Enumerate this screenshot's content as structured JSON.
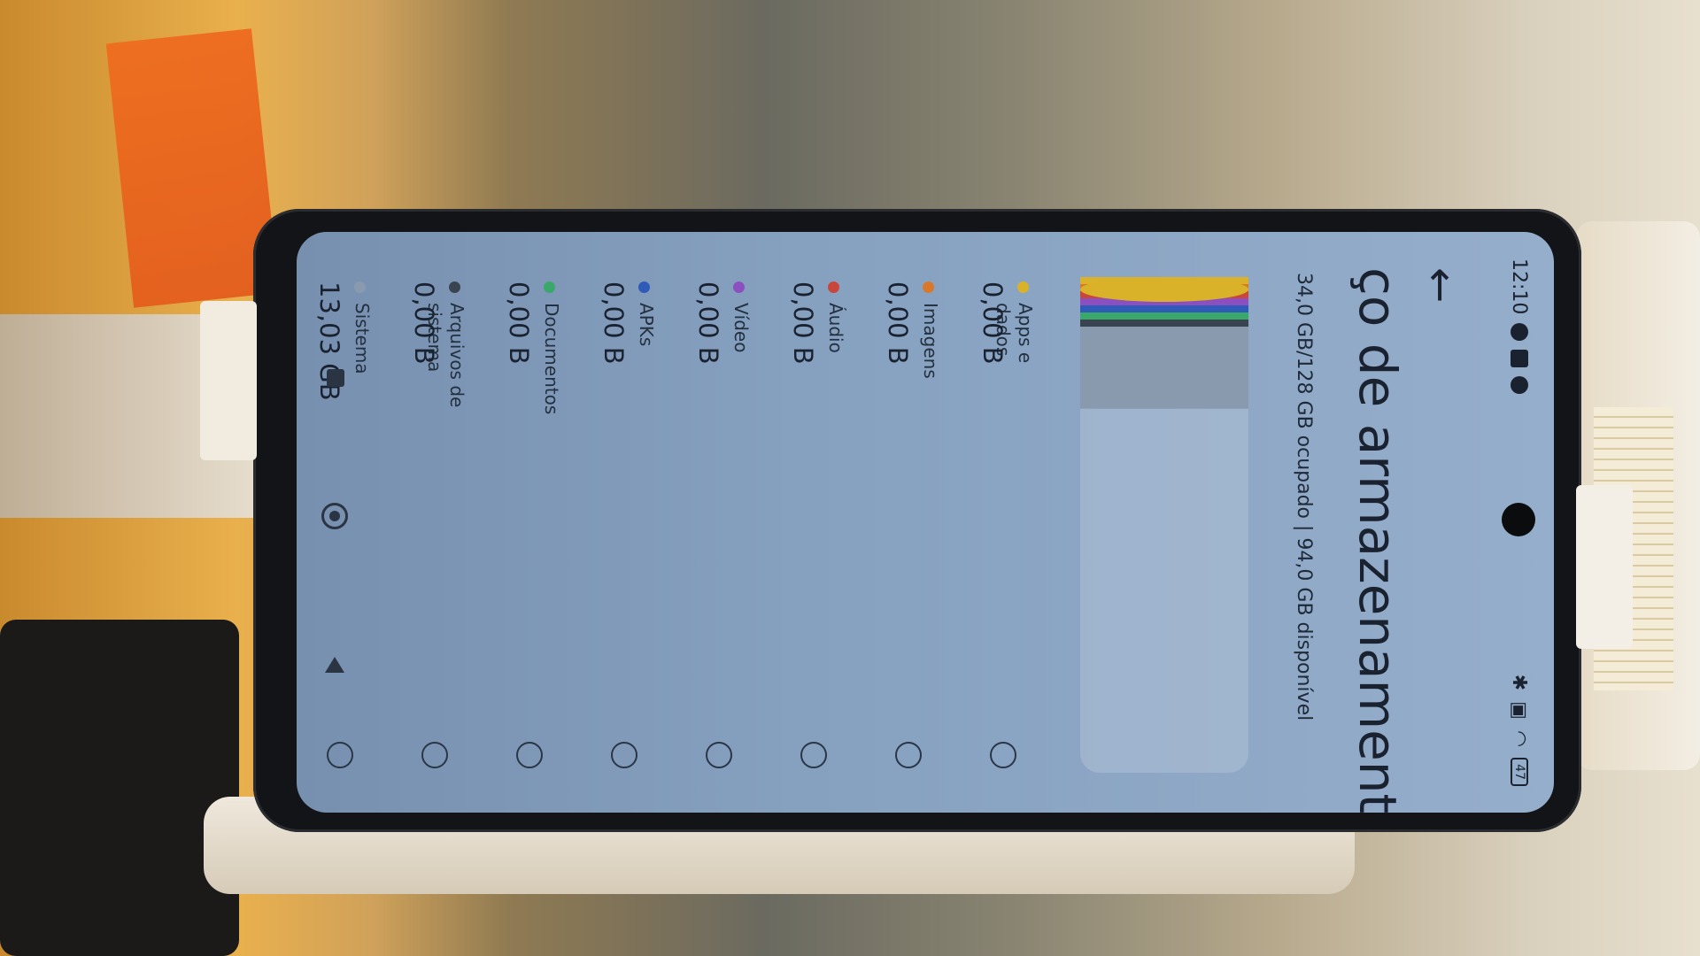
{
  "status_bar": {
    "time": "12:10",
    "battery": "47"
  },
  "header": {
    "back_icon": "arrow-back-icon",
    "title": "ço de armazenamento"
  },
  "storage": {
    "summary": "34,0 GB/128 GB ocupado | 94,0 GB disponível",
    "used_gb": 34.0,
    "total_gb": 128,
    "free_gb": 94.0
  },
  "chart_data": {
    "type": "bar",
    "title": "",
    "categories": [
      "Apps e dados",
      "Imagens",
      "Áudio",
      "Vídeo",
      "APKs",
      "Documentos",
      "Arquivos de sistema",
      "Sistema"
    ],
    "values_text": [
      "0,00 B",
      "0,00 B",
      "0,00 B",
      "0,00 B",
      "0,00 B",
      "0,00 B",
      "0,00 B",
      "13,03 GB"
    ],
    "colors": [
      "#d9b22a",
      "#d9782a",
      "#c9463a",
      "#8b4fc0",
      "#2f5ab8",
      "#3aa86a",
      "#3a4450",
      "#8a9aae"
    ],
    "total": "128 GB",
    "used": "34,0 GB"
  },
  "legend": [
    {
      "label": "Apps e dados",
      "value": "0,00 B",
      "color": "#d9b22a"
    },
    {
      "label": "Imagens",
      "value": "0,00 B",
      "color": "#d9782a"
    },
    {
      "label": "Áudio",
      "value": "0,00 B",
      "color": "#c9463a"
    },
    {
      "label": "Vídeo",
      "value": "0,00 B",
      "color": "#8b4fc0"
    },
    {
      "label": "APKs",
      "value": "0,00 B",
      "color": "#2f5ab8"
    },
    {
      "label": "Documentos",
      "value": "0,00 B",
      "color": "#3aa86a"
    },
    {
      "label": "Arquivos de sistema",
      "value": "0,00 B",
      "color": "#3a4450"
    },
    {
      "label": "Sistema",
      "value": "13,03 GB",
      "color": "#8a9aae"
    }
  ],
  "nav": {
    "recent_icon": "recent-apps-icon",
    "home_icon": "home-icon",
    "back_icon": "back-triangle-icon"
  }
}
